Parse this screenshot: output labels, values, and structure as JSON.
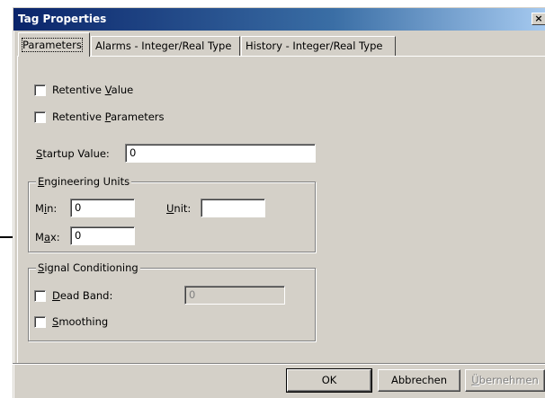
{
  "window": {
    "title": "Tag Properties",
    "close_glyph": "×"
  },
  "tabs": [
    {
      "label": "Parameters",
      "active": true
    },
    {
      "label": "Alarms - Integer/Real Type",
      "active": false
    },
    {
      "label": "History - Integer/Real Type",
      "active": false
    }
  ],
  "parameters": {
    "retentive_value": {
      "pre": "Retentive ",
      "mnemonic": "V",
      "post": "alue",
      "checked": false
    },
    "retentive_parameters": {
      "pre": "Retentive ",
      "mnemonic": "P",
      "post": "arameters",
      "checked": false
    },
    "startup_value": {
      "mnemonic": "S",
      "post": "tartup Value:",
      "value": "0"
    }
  },
  "engineering_units": {
    "title_mnemonic": "E",
    "title_post": "ngineering Units",
    "min": {
      "pre": "M",
      "mnemonic": "i",
      "post": "n:",
      "value": "0"
    },
    "max": {
      "pre": "M",
      "mnemonic": "a",
      "post": "x:",
      "value": "0"
    },
    "unit": {
      "mnemonic": "U",
      "post": "nit:",
      "value": ""
    }
  },
  "signal_conditioning": {
    "title_mnemonic": "S",
    "title_post": "ignal Conditioning",
    "dead_band": {
      "mnemonic": "D",
      "post": "ead Band:",
      "value": "0",
      "checked": false
    },
    "smoothing": {
      "mnemonic": "S",
      "post": "moothing",
      "checked": false
    }
  },
  "buttons": {
    "ok": "OK",
    "cancel": "Abbrechen",
    "apply": {
      "mnemonic": "Ü",
      "post": "bernehmen"
    }
  },
  "colors": {
    "dialog_bg": "#d4d0c8",
    "titlebar": "#0a246a",
    "accent_arrow": "#000000"
  }
}
